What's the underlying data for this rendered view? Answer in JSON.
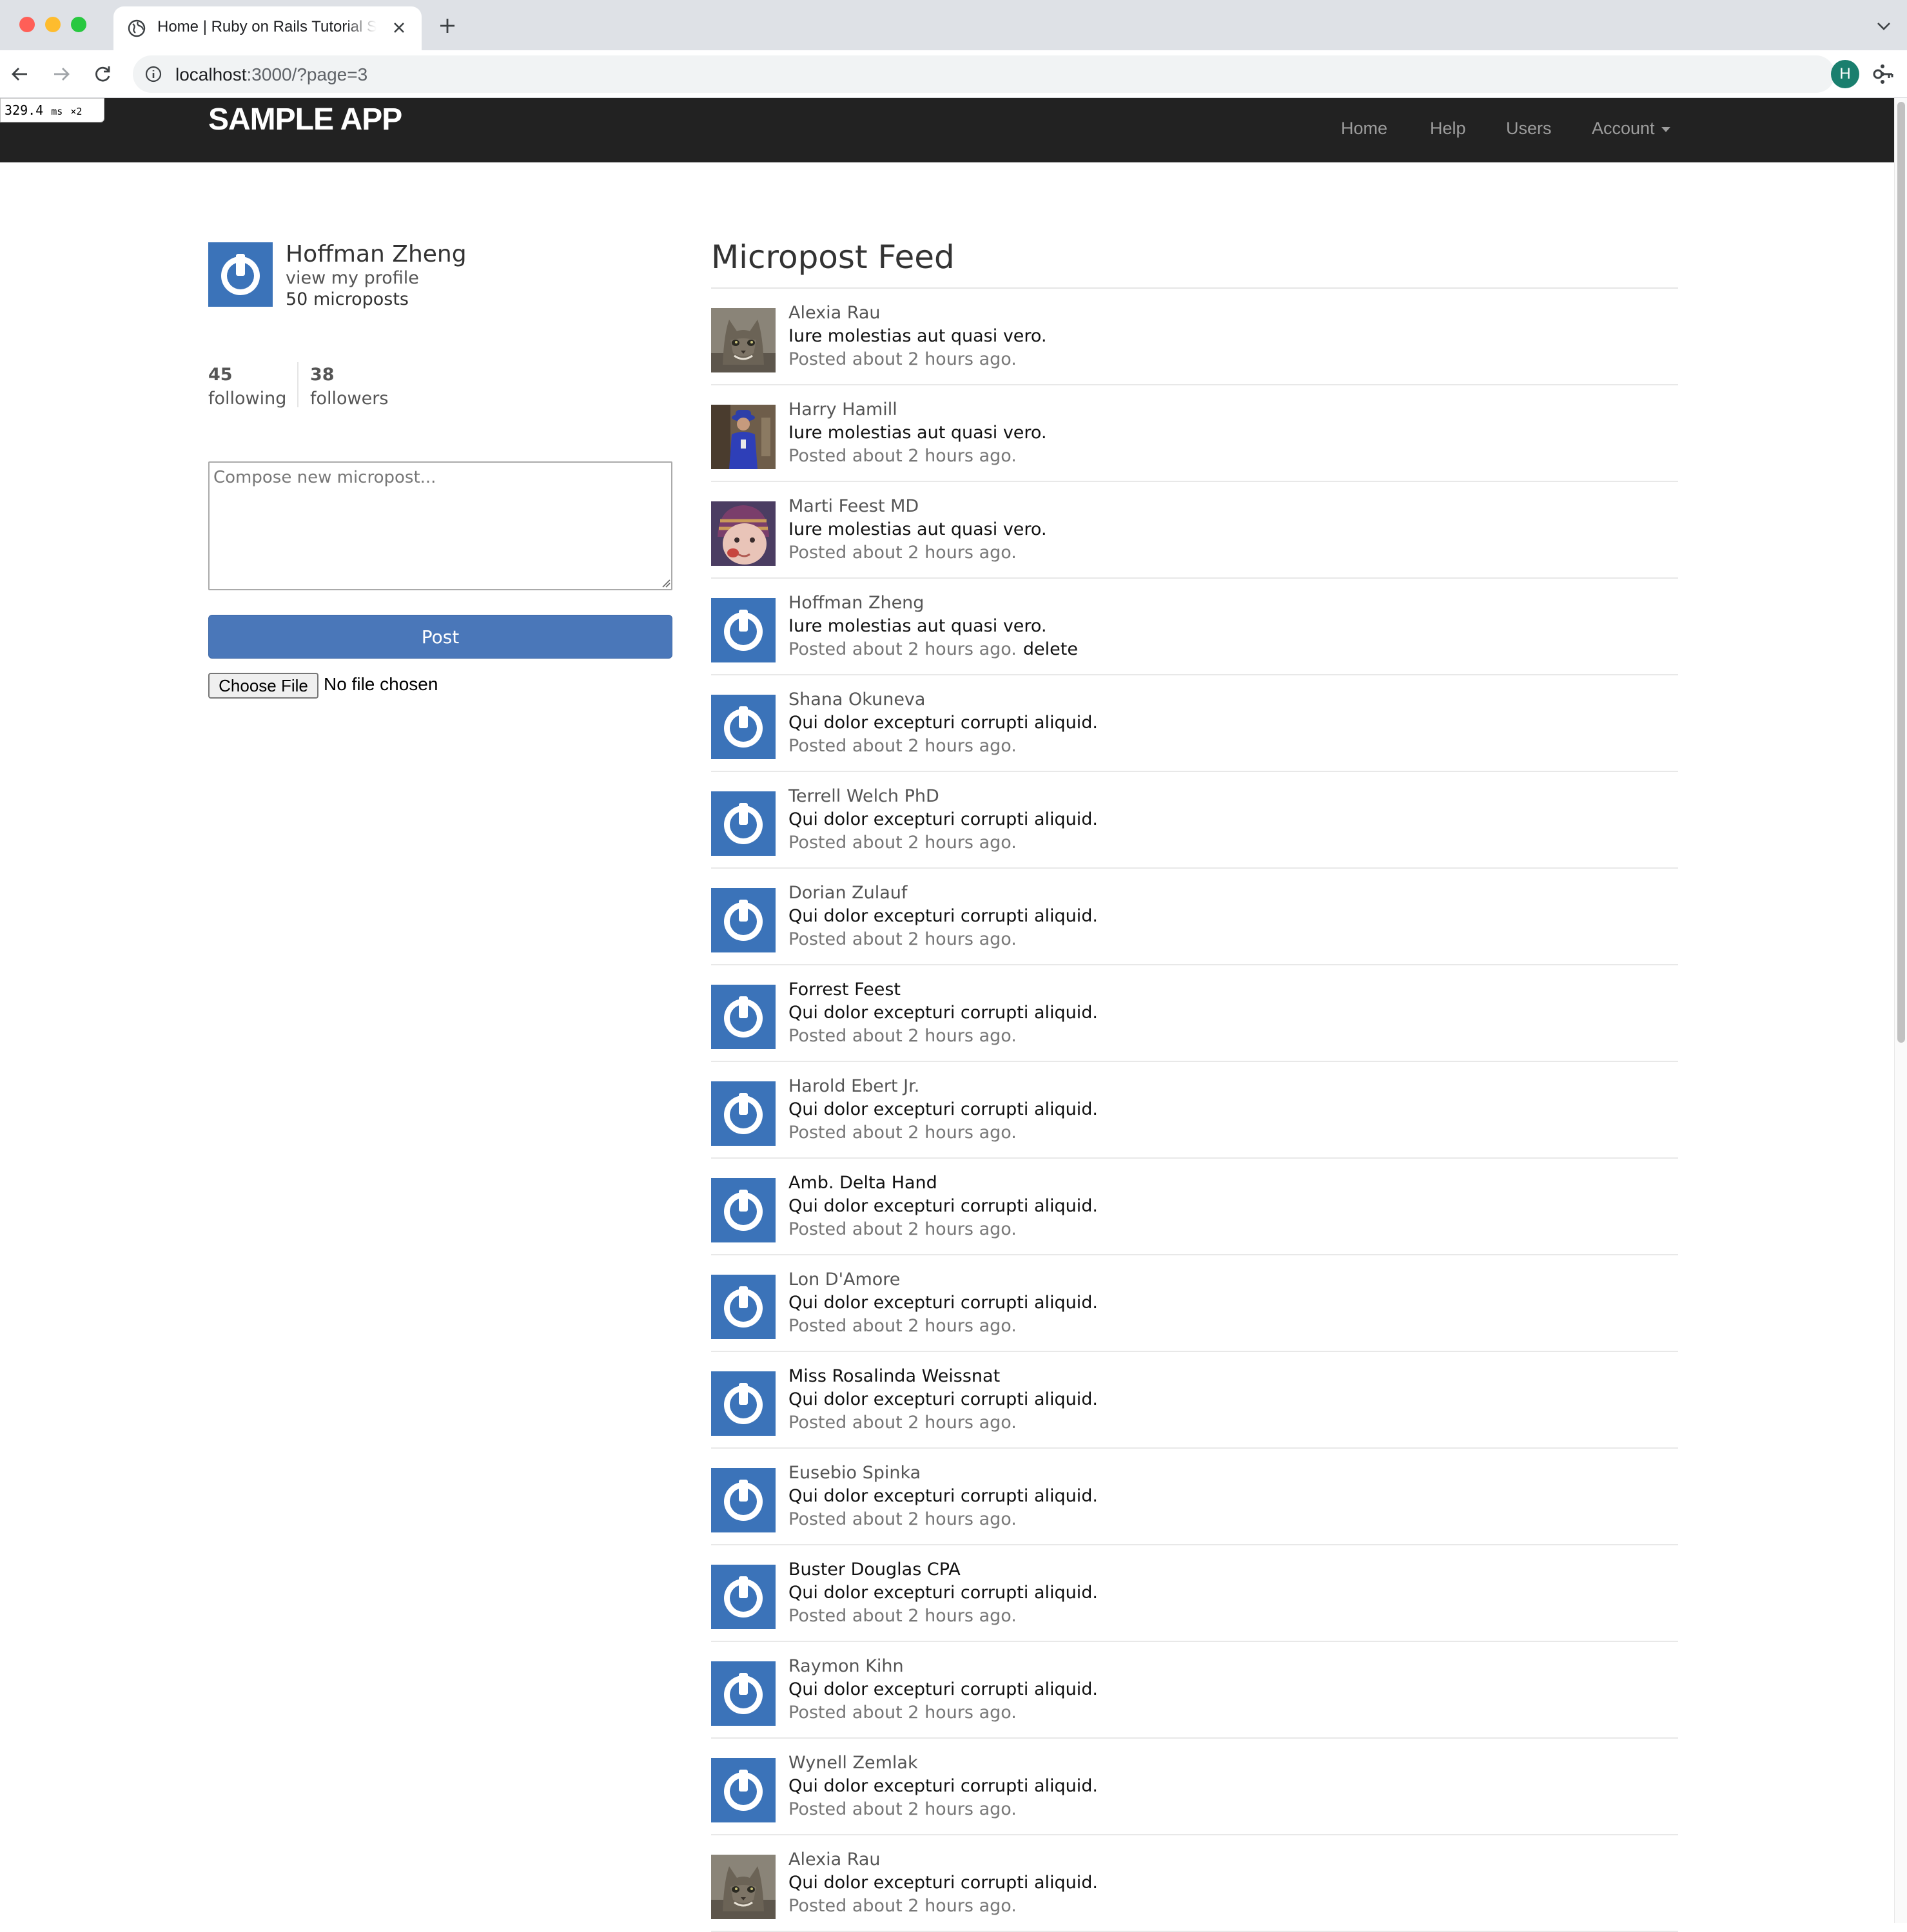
{
  "browser": {
    "tab_title": "Home | Ruby on Rails Tutorial Sample App",
    "url_host": "localhost",
    "url_path": ":3000/?page=3",
    "profile_initial": "H"
  },
  "perf_badge": {
    "value": "329.4",
    "unit": "ms",
    "multiplier": "×2"
  },
  "header": {
    "logo": "SAMPLE APP",
    "nav": [
      "Home",
      "Help",
      "Users",
      "Account"
    ]
  },
  "sidebar": {
    "name": "Hoffman Zheng",
    "profile_link": "view my profile",
    "micropost_count": "50 microposts",
    "following_count": "45",
    "following_label": "following",
    "followers_count": "38",
    "followers_label": "followers",
    "compose_placeholder": "Compose new micropost...",
    "post_button": "Post",
    "file_button": "Choose File",
    "file_status": "No file chosen"
  },
  "feed": {
    "title": "Micropost Feed",
    "delete_label": "delete",
    "items": [
      {
        "user": "Alexia Rau",
        "content": "Iure molestias aut quasi vero.",
        "time": "Posted about 2 hours ago.",
        "avatar": "photo-cat"
      },
      {
        "user": "Harry Hamill",
        "content": "Iure molestias aut quasi vero.",
        "time": "Posted about 2 hours ago.",
        "avatar": "photo-person"
      },
      {
        "user": "Marti Feest MD",
        "content": "Iure molestias aut quasi vero.",
        "time": "Posted about 2 hours ago.",
        "avatar": "photo-child"
      },
      {
        "user": "Hoffman Zheng",
        "content": "Iure molestias aut quasi vero.",
        "time": "Posted about 2 hours ago.",
        "avatar": "gravatar-default",
        "own": true
      },
      {
        "user": "Shana Okuneva",
        "content": "Qui dolor excepturi corrupti aliquid.",
        "time": "Posted about 2 hours ago.",
        "avatar": "gravatar-default"
      },
      {
        "user": "Terrell Welch PhD",
        "content": "Qui dolor excepturi corrupti aliquid.",
        "time": "Posted about 2 hours ago.",
        "avatar": "gravatar-default"
      },
      {
        "user": "Dorian Zulauf",
        "content": "Qui dolor excepturi corrupti aliquid.",
        "time": "Posted about 2 hours ago.",
        "avatar": "gravatar-default"
      },
      {
        "user": "Forrest Feest",
        "content": "Qui dolor excepturi corrupti aliquid.",
        "time": "Posted about 2 hours ago.",
        "avatar": "gravatar-default",
        "visited": true
      },
      {
        "user": "Harold Ebert Jr.",
        "content": "Qui dolor excepturi corrupti aliquid.",
        "time": "Posted about 2 hours ago.",
        "avatar": "gravatar-default"
      },
      {
        "user": "Amb. Delta Hand",
        "content": "Qui dolor excepturi corrupti aliquid.",
        "time": "Posted about 2 hours ago.",
        "avatar": "gravatar-default",
        "visited": true
      },
      {
        "user": "Lon D'Amore",
        "content": "Qui dolor excepturi corrupti aliquid.",
        "time": "Posted about 2 hours ago.",
        "avatar": "gravatar-default"
      },
      {
        "user": "Miss Rosalinda Weissnat",
        "content": "Qui dolor excepturi corrupti aliquid.",
        "time": "Posted about 2 hours ago.",
        "avatar": "gravatar-default",
        "visited": true
      },
      {
        "user": "Eusebio Spinka",
        "content": "Qui dolor excepturi corrupti aliquid.",
        "time": "Posted about 2 hours ago.",
        "avatar": "gravatar-default"
      },
      {
        "user": "Buster Douglas CPA",
        "content": "Qui dolor excepturi corrupti aliquid.",
        "time": "Posted about 2 hours ago.",
        "avatar": "gravatar-default",
        "visited": true
      },
      {
        "user": "Raymon Kihn",
        "content": "Qui dolor excepturi corrupti aliquid.",
        "time": "Posted about 2 hours ago.",
        "avatar": "gravatar-default"
      },
      {
        "user": "Wynell Zemlak",
        "content": "Qui dolor excepturi corrupti aliquid.",
        "time": "Posted about 2 hours ago.",
        "avatar": "gravatar-default"
      },
      {
        "user": "Alexia Rau",
        "content": "Qui dolor excepturi corrupti aliquid.",
        "time": "Posted about 2 hours ago.",
        "avatar": "photo-cat"
      }
    ]
  },
  "colors": {
    "header_bg": "#222222",
    "gravatar_blue": "#3b73b9",
    "post_button": "#4a77b9",
    "chrome_tabbar": "#dee1e6"
  }
}
